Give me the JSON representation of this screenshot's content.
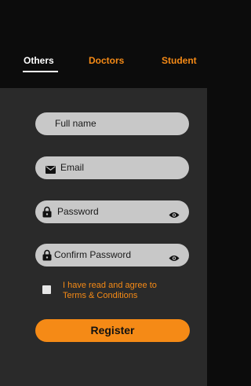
{
  "tabs": [
    {
      "label": "Others",
      "active": true
    },
    {
      "label": "Doctors",
      "active": false
    },
    {
      "label": "Student",
      "active": false
    }
  ],
  "form": {
    "fullname_placeholder": "Full name",
    "email_placeholder": "Email",
    "password_placeholder": "Password",
    "confirm_placeholder": "Confirm Password"
  },
  "agreement": {
    "line1": "I have read and agree to",
    "line2": "Terms & Conditions",
    "checked": false
  },
  "register_label": "Register",
  "colors": {
    "accent": "#f58a16",
    "header_bg": "#0c0c0c",
    "body_bg": "#2a2a2a",
    "field_bg": "#c8c8c8"
  },
  "icons": {
    "email": "envelope-icon",
    "password": "lock-icon",
    "visibility": "eye-icon"
  }
}
